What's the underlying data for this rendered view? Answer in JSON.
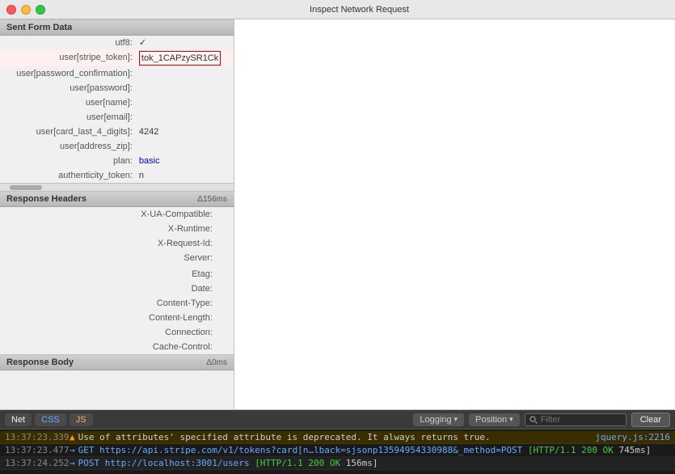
{
  "window": {
    "title": "Inspect Network Request"
  },
  "leftPanel": {
    "sections": [
      {
        "id": "sent-form-data",
        "label": "Sent Form Data",
        "timing": "",
        "rows": [
          {
            "key": "utf8:",
            "value": "✓",
            "type": "check"
          },
          {
            "key": "user[stripe_token]:",
            "value": "tok_1CAPzySR1Ck",
            "type": "token",
            "highlighted": true
          },
          {
            "key": "user[password_confirmation]:",
            "value": "",
            "type": "text"
          },
          {
            "key": "user[password]:",
            "value": "",
            "type": "text"
          },
          {
            "key": "user[name]:",
            "value": "",
            "type": "text"
          },
          {
            "key": "user[email]:",
            "value": "",
            "type": "text"
          },
          {
            "key": "user[card_last_4_digits]:",
            "value": "4242",
            "type": "text"
          },
          {
            "key": "user[address_zip]:",
            "value": "",
            "type": "text"
          },
          {
            "key": "plan:",
            "value": "basic",
            "type": "link"
          },
          {
            "key": "authenticity_token:",
            "value": "n",
            "type": "text"
          }
        ]
      },
      {
        "id": "response-headers",
        "label": "Response Headers",
        "timing": "Δ156ms",
        "rows": [
          {
            "key": "X-UA-Compatible:",
            "value": "",
            "type": "text"
          },
          {
            "key": "X-Runtime:",
            "value": "",
            "type": "text"
          },
          {
            "key": "X-Request-Id:",
            "value": "",
            "type": "text"
          },
          {
            "key": "Server:",
            "value": "",
            "type": "text"
          },
          {
            "key": "",
            "value": "",
            "type": "text"
          },
          {
            "key": "Etag:",
            "value": "",
            "type": "text"
          },
          {
            "key": "Date:",
            "value": "",
            "type": "text"
          },
          {
            "key": "Content-Type:",
            "value": "",
            "type": "text"
          },
          {
            "key": "Content-Length:",
            "value": "",
            "type": "text"
          },
          {
            "key": "Connection:",
            "value": "",
            "type": "text"
          },
          {
            "key": "Cache-Control:",
            "value": "",
            "type": "text"
          }
        ]
      },
      {
        "id": "response-body",
        "label": "Response Body",
        "timing": "Δ0ms",
        "rows": []
      }
    ]
  },
  "console": {
    "tabs": [
      {
        "id": "net",
        "label": "Net",
        "active": true
      },
      {
        "id": "css",
        "label": "CSS",
        "color": "css"
      },
      {
        "id": "js",
        "label": "JS",
        "color": "js"
      }
    ],
    "logging_label": "Logging",
    "position_label": "Position",
    "filter_placeholder": "Filter",
    "clear_label": "Clear",
    "logs": [
      {
        "time": "13:37:23.339",
        "type": "warning",
        "icon": "▲",
        "text": "Use of attributes' specified attribute is deprecated. It always returns true.",
        "source": "jquery.js:2216"
      },
      {
        "time": "13:37:23.477",
        "type": "info",
        "icon": "→",
        "method": "GET",
        "url": "https://api.stripe.com/v1/tokens?card[n…lback=sjsonp13594954330988&_method=POST",
        "status": "[HTTP/1.1 200 OK",
        "timing": "745ms]",
        "source": ""
      },
      {
        "time": "13:37:24.252",
        "type": "info2",
        "icon": "→",
        "method": "POST",
        "url": "http://localhost:3001/users",
        "status": "[HTTP/1.1 200 OK",
        "timing": "156ms]",
        "source": ""
      }
    ]
  }
}
